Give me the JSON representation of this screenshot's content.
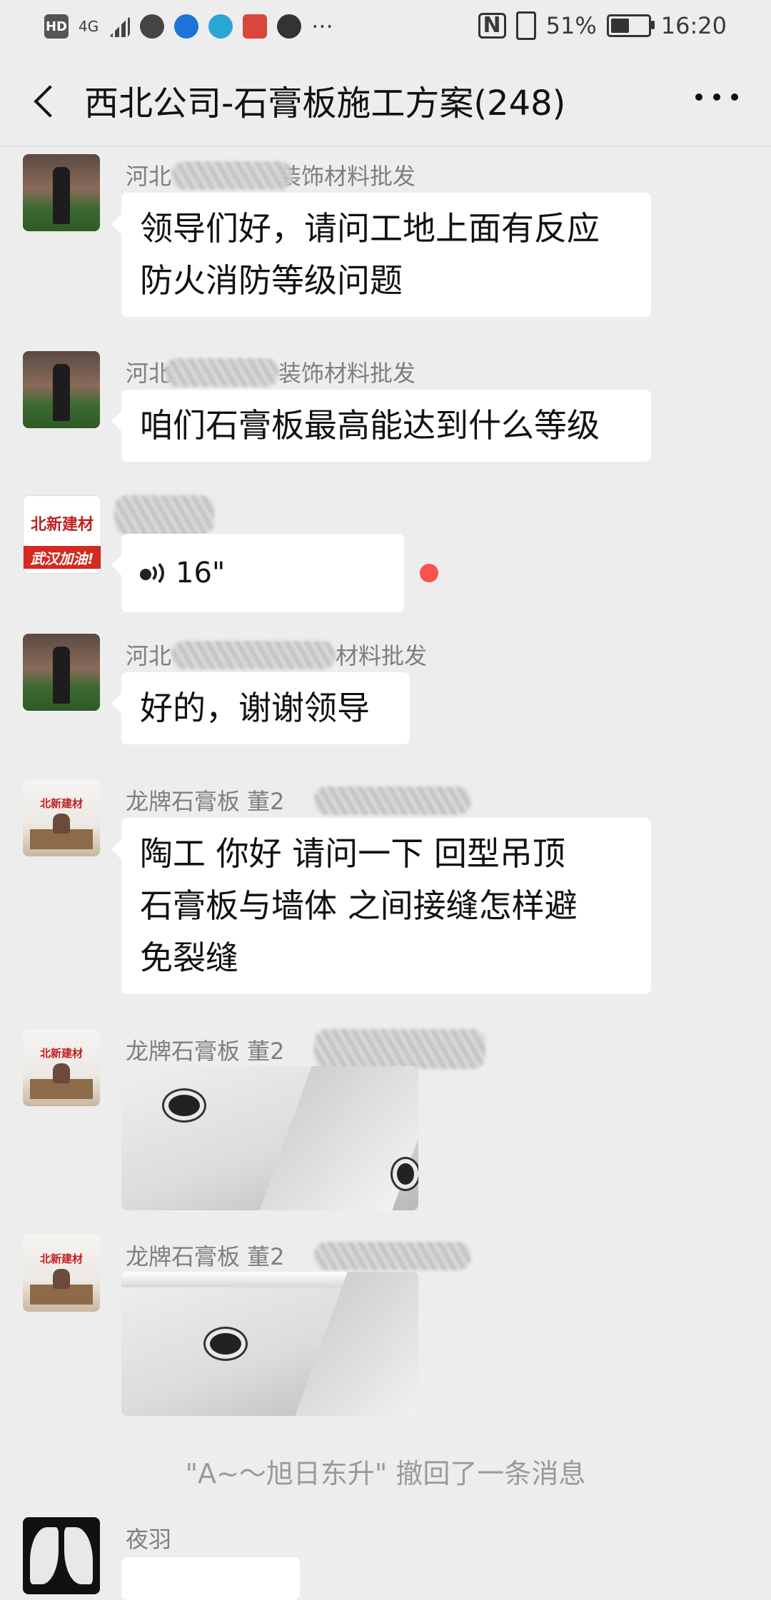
{
  "status_bar": {
    "hd": "HD",
    "network": "4G",
    "nfc": "N",
    "battery_percent": "51%",
    "battery_level": 0.51,
    "time": "16:20",
    "more": "···"
  },
  "header": {
    "title": "西北公司-石膏板施工方案(248)"
  },
  "messages": [
    {
      "name": "河北",
      "name_suffix": "装饰材料批发",
      "lines": [
        "领导们好，请问工地上面有反应",
        "防火消防等级问题"
      ]
    },
    {
      "name": "河北",
      "name_suffix": "装饰材料批发",
      "lines": [
        "咱们石膏板最高能达到什么等级"
      ]
    },
    {
      "avatar_top": "北新建材",
      "avatar_bottom": "武汉加油!",
      "voice_duration": "16\""
    },
    {
      "name": "河北",
      "name_suffix": "材料批发",
      "lines": [
        "好的，谢谢领导"
      ]
    },
    {
      "name": "龙牌石膏板 董2",
      "lines": [
        "陶工 你好 请问一下  回型吊顶",
        "石膏板与墙体  之间接缝怎样避",
        "免裂缝"
      ]
    },
    {
      "name": "龙牌石膏板 董2"
    },
    {
      "name": "龙牌石膏板 董2"
    },
    {
      "name": "夜羽"
    }
  ],
  "system_note": "\"A~～旭日东升\" 撤回了一条消息",
  "office_sign": "北新建材"
}
